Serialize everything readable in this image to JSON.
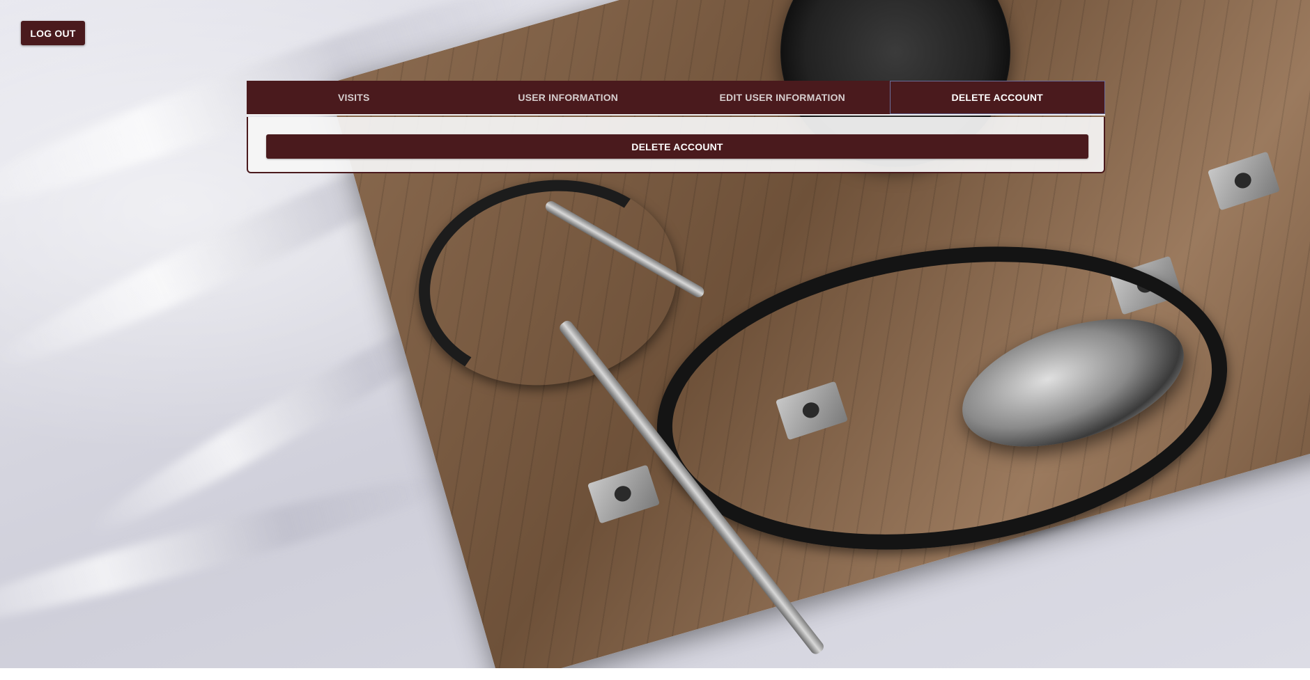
{
  "header": {
    "logout_label": "LOG OUT"
  },
  "tabs": [
    {
      "label": "VISITS",
      "active": false
    },
    {
      "label": "USER INFORMATION",
      "active": false
    },
    {
      "label": "EDIT USER INFORMATION",
      "active": false
    },
    {
      "label": "DELETE ACCOUNT",
      "active": true
    }
  ],
  "content": {
    "delete_button_label": "DELETE ACCOUNT"
  },
  "colors": {
    "primary": "#4a1a1d",
    "active_tab_border": "#6b6d9a",
    "panel_background": "#f5f5f5"
  },
  "background": {
    "image": "stethoscope-and-blood-pressure-cuff-photo"
  }
}
